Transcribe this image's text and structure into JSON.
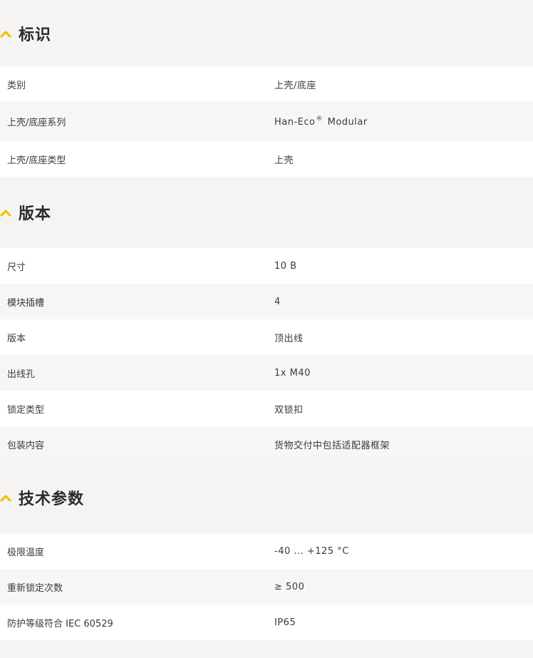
{
  "accent_color": "#f2c300",
  "sections": [
    {
      "icon": "chevron-up-icon",
      "title": "标识",
      "rows": [
        {
          "label": "类别",
          "value": "上壳/底座"
        },
        {
          "label": "上壳/底座系列",
          "value_prefix": "Han-Eco",
          "value_mark": "®",
          "value_suffix": " Modular"
        },
        {
          "label": "上壳/底座类型",
          "value": "上壳"
        }
      ]
    },
    {
      "icon": "chevron-up-icon",
      "title": "版本",
      "rows": [
        {
          "label": "尺寸",
          "value": "10 B"
        },
        {
          "label": "模块插槽",
          "value": "4"
        },
        {
          "label": "版本",
          "value": "顶出线"
        },
        {
          "label": "出线孔",
          "value": "1x M40"
        },
        {
          "label": "锁定类型",
          "value": "双锁扣"
        },
        {
          "label": "包装内容",
          "value": "货物交付中包括适配器框架"
        }
      ]
    },
    {
      "icon": "chevron-up-icon",
      "title": "技术参数",
      "rows": [
        {
          "label": "极限温度",
          "value": "-40 ... +125 °C"
        },
        {
          "label": "重新锁定次数",
          "value": "≥ 500"
        },
        {
          "label": "防护等级符合 IEC 60529",
          "value": "IP65"
        }
      ]
    }
  ]
}
